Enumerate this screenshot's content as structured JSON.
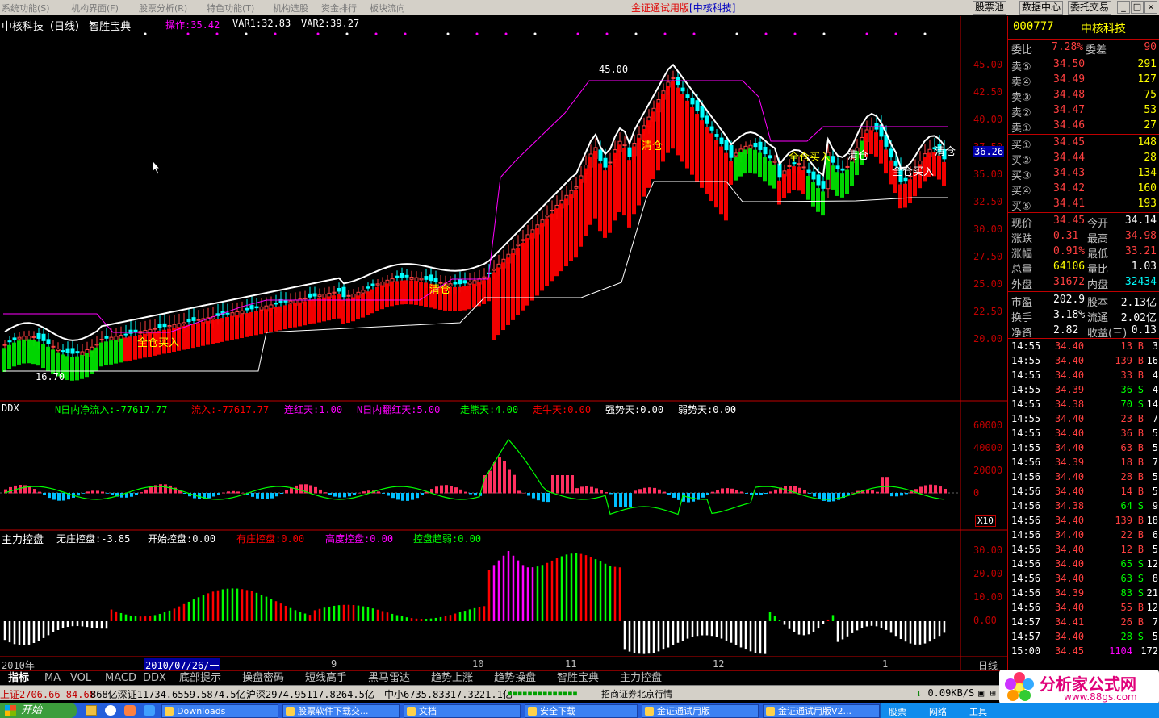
{
  "menu": {
    "items": [
      "系统功能(S)",
      "机构界面(F)",
      "股票分析(R)",
      "特色功能(T)",
      "机构选股",
      "资金排行",
      "板块流向"
    ],
    "title_red": "金证通试用版",
    "title_blue": "[中核科技]",
    "buttons": [
      "股票池",
      "数据中心",
      "委托交易"
    ],
    "win_min": "_",
    "win_max": "□",
    "win_close": "×"
  },
  "chart": {
    "main_title": "中核科技（日线） 智胜宝典",
    "main_indicators": [
      {
        "label": "操作:35.42",
        "color": "#ff00ff"
      },
      {
        "label": "VAR1:32.83",
        "color": "#ffffff"
      },
      {
        "label": "VAR2:39.27",
        "color": "#ffffff"
      }
    ],
    "price_axis": [
      "45.00",
      "42.50",
      "40.00",
      "37.50",
      "35.00",
      "32.50",
      "30.00",
      "27.50",
      "25.00",
      "22.50",
      "20.00"
    ],
    "current_price_marker": "36.26",
    "high_label": "45.00",
    "low_label": "16.70",
    "signals": [
      {
        "text": "全仓买入",
        "color": "#ffff00"
      },
      {
        "text": "清仓",
        "color": "#ffff00"
      },
      {
        "text": "清仓",
        "color": "#ffff00"
      },
      {
        "text": "全仓买入",
        "color": "#ffff00"
      },
      {
        "text": "清仓",
        "color": "#ffffff"
      },
      {
        "text": "全仓买入",
        "color": "#ffffff"
      },
      {
        "text": "清仓",
        "color": "#ffffff"
      }
    ],
    "ddx_title": "DDX",
    "ddx_indicators": [
      {
        "label": "N日内净流入:-77617.77",
        "color": "#00ff00"
      },
      {
        "label": "流入:-77617.77",
        "color": "#ff0000"
      },
      {
        "label": "连红天:1.00",
        "color": "#ff00ff"
      },
      {
        "label": "N日内翻红天:5.00",
        "color": "#ff00ff"
      },
      {
        "label": "走熊天:4.00",
        "color": "#00ff00"
      },
      {
        "label": "走牛天:0.00",
        "color": "#ff0000"
      },
      {
        "label": "强势天:0.00",
        "color": "#ffffff"
      },
      {
        "label": "弱势天:0.00",
        "color": "#ffffff"
      }
    ],
    "ddx_axis": [
      "60000",
      "40000",
      "20000",
      "0"
    ],
    "ddx_scale": "X10",
    "ctrl_title": "主力控盘",
    "ctrl_indicators": [
      {
        "label": "无庄控盘:-3.85",
        "color": "#ffffff"
      },
      {
        "label": "开始控盘:0.00",
        "color": "#ffffff"
      },
      {
        "label": "有庄控盘:0.00",
        "color": "#ff0000"
      },
      {
        "label": "高度控盘:0.00",
        "color": "#ff00ff"
      },
      {
        "label": "控盘趋弱:0.00",
        "color": "#00ff00"
      }
    ],
    "ctrl_axis": [
      "30.00",
      "20.00",
      "10.00",
      "0.00"
    ],
    "date_axis": [
      "2010年",
      "2010/07/26/一",
      "9",
      "10",
      "11",
      "12",
      "1"
    ],
    "period": "日线"
  },
  "quote": {
    "code": "000777",
    "name": "中核科技",
    "weibi": {
      "label": "委比",
      "value": "7.28%",
      "label2": "委差",
      "value2": "90"
    },
    "asks": [
      {
        "label": "卖⑤",
        "price": "34.50",
        "vol": "291"
      },
      {
        "label": "卖④",
        "price": "34.49",
        "vol": "127"
      },
      {
        "label": "卖③",
        "price": "34.48",
        "vol": "75"
      },
      {
        "label": "卖②",
        "price": "34.47",
        "vol": "53"
      },
      {
        "label": "卖①",
        "price": "34.46",
        "vol": "27"
      }
    ],
    "bids": [
      {
        "label": "买①",
        "price": "34.45",
        "vol": "148"
      },
      {
        "label": "买②",
        "price": "34.44",
        "vol": "28"
      },
      {
        "label": "买③",
        "price": "34.43",
        "vol": "134"
      },
      {
        "label": "买④",
        "price": "34.42",
        "vol": "160"
      },
      {
        "label": "买⑤",
        "price": "34.41",
        "vol": "193"
      }
    ],
    "stats": [
      {
        "l1": "现价",
        "v1": "34.45",
        "c1": "#ff4040",
        "l2": "今开",
        "v2": "34.14",
        "c2": "#ffffff"
      },
      {
        "l1": "涨跌",
        "v1": "0.31",
        "c1": "#ff4040",
        "l2": "最高",
        "v2": "34.98",
        "c2": "#ff4040"
      },
      {
        "l1": "涨幅",
        "v1": "0.91%",
        "c1": "#ff4040",
        "l2": "最低",
        "v2": "33.21",
        "c2": "#ff4040"
      },
      {
        "l1": "总量",
        "v1": "64106",
        "c1": "#ffff00",
        "l2": "量比",
        "v2": "1.03",
        "c2": "#ffffff"
      },
      {
        "l1": "外盘",
        "v1": "31672",
        "c1": "#ff4040",
        "l2": "内盘",
        "v2": "32434",
        "c2": "#00ffff"
      }
    ],
    "stats2": [
      {
        "l1": "市盈",
        "v1": "202.9",
        "l2": "股本",
        "v2": "2.13亿"
      },
      {
        "l1": "换手",
        "v1": "3.18%",
        "l2": "流通",
        "v2": "2.02亿"
      },
      {
        "l1": "净资",
        "v1": "2.82",
        "l2": "收益(三)",
        "v2": "0.13"
      }
    ],
    "ticks": [
      {
        "t": "14:55",
        "p": "34.40",
        "v": "13",
        "d": "B",
        "n": "3"
      },
      {
        "t": "14:55",
        "p": "34.40",
        "v": "139",
        "d": "B",
        "n": "16"
      },
      {
        "t": "14:55",
        "p": "34.40",
        "v": "33",
        "d": "B",
        "n": "4"
      },
      {
        "t": "14:55",
        "p": "34.39",
        "v": "36",
        "d": "S",
        "n": "4"
      },
      {
        "t": "14:55",
        "p": "34.38",
        "v": "70",
        "d": "S",
        "n": "14"
      },
      {
        "t": "14:55",
        "p": "34.40",
        "v": "23",
        "d": "B",
        "n": "7"
      },
      {
        "t": "14:55",
        "p": "34.40",
        "v": "36",
        "d": "B",
        "n": "5"
      },
      {
        "t": "14:55",
        "p": "34.40",
        "v": "63",
        "d": "B",
        "n": "5"
      },
      {
        "t": "14:56",
        "p": "34.39",
        "v": "18",
        "d": "B",
        "n": "7"
      },
      {
        "t": "14:56",
        "p": "34.40",
        "v": "28",
        "d": "B",
        "n": "5"
      },
      {
        "t": "14:56",
        "p": "34.40",
        "v": "14",
        "d": "B",
        "n": "5"
      },
      {
        "t": "14:56",
        "p": "34.38",
        "v": "64",
        "d": "S",
        "n": "9"
      },
      {
        "t": "14:56",
        "p": "34.40",
        "v": "139",
        "d": "B",
        "n": "18"
      },
      {
        "t": "14:56",
        "p": "34.40",
        "v": "22",
        "d": "B",
        "n": "6"
      },
      {
        "t": "14:56",
        "p": "34.40",
        "v": "12",
        "d": "B",
        "n": "5"
      },
      {
        "t": "14:56",
        "p": "34.40",
        "v": "65",
        "d": "S",
        "n": "12"
      },
      {
        "t": "14:56",
        "p": "34.40",
        "v": "63",
        "d": "S",
        "n": "8"
      },
      {
        "t": "14:56",
        "p": "34.39",
        "v": "83",
        "d": "S",
        "n": "21"
      },
      {
        "t": "14:56",
        "p": "34.40",
        "v": "55",
        "d": "B",
        "n": "12"
      },
      {
        "t": "14:57",
        "p": "34.41",
        "v": "26",
        "d": "B",
        "n": "7"
      },
      {
        "t": "14:57",
        "p": "34.40",
        "v": "28",
        "d": "S",
        "n": "5"
      },
      {
        "t": "15:00",
        "p": "34.45",
        "v": "1104",
        "d": "",
        "n": "172"
      }
    ]
  },
  "tabs": [
    "指标",
    "MA",
    "VOL",
    "MACD",
    "DDX",
    "底部提示",
    "操盘密码",
    "短线高手",
    "黑马雷达",
    "趋势上涨",
    "趋势操盘",
    "智胜宝典",
    "主力控盘"
  ],
  "ticker": {
    "items": [
      {
        "text": "上证2706.66-84.68",
        "color": "#c00000"
      },
      {
        "text": "868亿深证11734.6559.5874.5亿",
        "color": "#000000"
      },
      {
        "text": "沪深2974.95117.8264.5亿",
        "color": "#000000"
      },
      {
        "text": "中小6735.83317.3221.1亿",
        "color": "#000000"
      }
    ],
    "speed": "0.09KB/S",
    "feed": "招商证券北京行情"
  },
  "taskbar": {
    "start": "开始",
    "apps": [
      "Downloads",
      "股票软件下载交...",
      "文档",
      "安全下载",
      "金证通试用版",
      "金证通试用版V2..."
    ],
    "tray": [
      "股票",
      "网络",
      "工具"
    ]
  },
  "watermark": {
    "text": "分析家公式网",
    "url": "www.88gs.com"
  }
}
